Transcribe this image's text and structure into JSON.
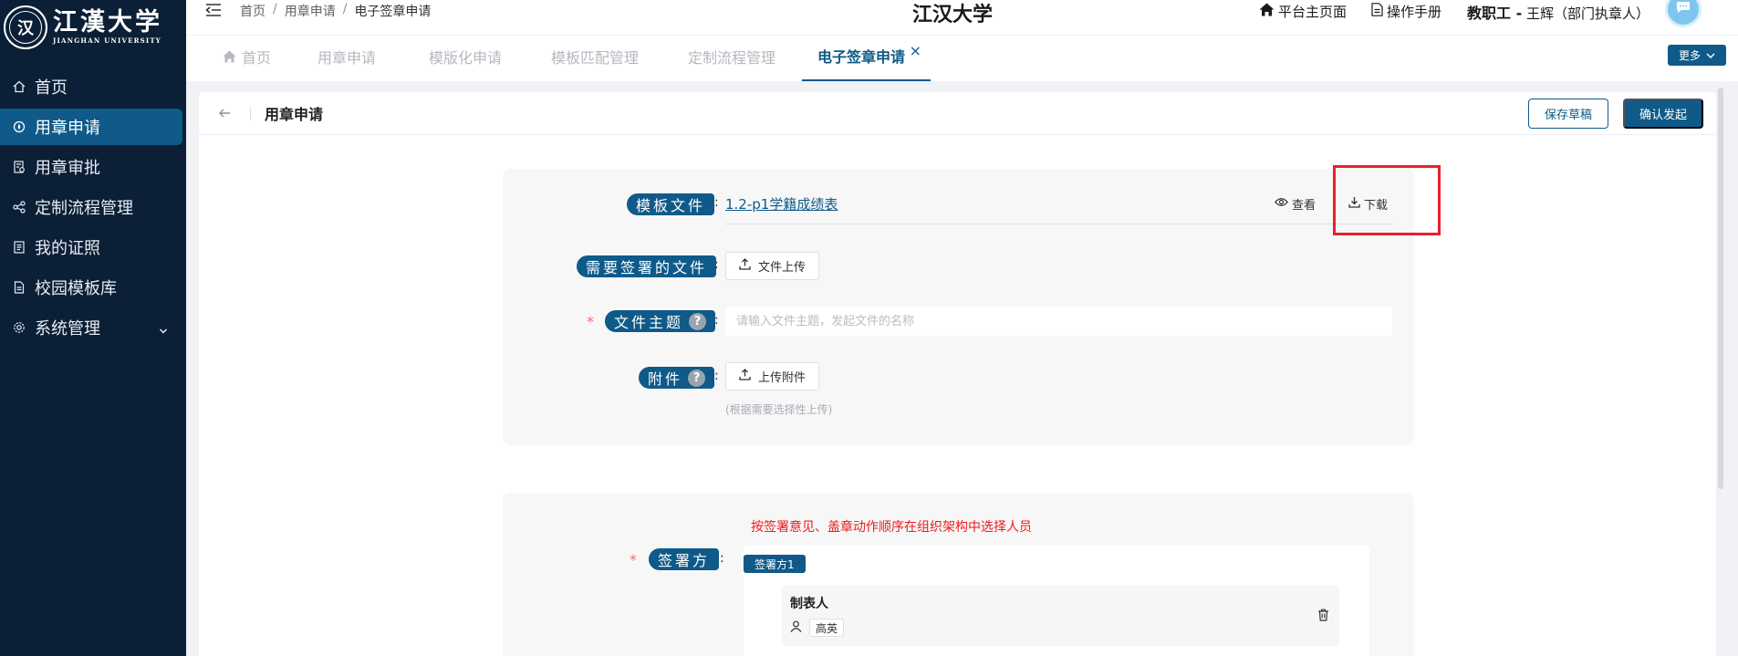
{
  "sidebar": {
    "logo_cn": "江漢大学",
    "logo_en": "JIANGHAN UNIVERSITY",
    "logo_seal": "汉",
    "items": [
      {
        "label": "首页",
        "icon": "home-icon"
      },
      {
        "label": "用章申请",
        "icon": "compass-icon"
      },
      {
        "label": "用章审批",
        "icon": "doc-check-icon"
      },
      {
        "label": "定制流程管理",
        "icon": "share-icon"
      },
      {
        "label": "我的证照",
        "icon": "list-icon"
      },
      {
        "label": "校园模板库",
        "icon": "document-icon"
      },
      {
        "label": "系统管理",
        "icon": "gear-icon"
      }
    ]
  },
  "header": {
    "breadcrumb": [
      "首页",
      "用章申请",
      "电子签章申请"
    ],
    "breadcrumb_sep": "/",
    "title": "江汉大学",
    "home_link": "平台主页面",
    "manual_link": "操作手册",
    "user_role": "教职工 -",
    "user_name": "王辉（部门执章人）"
  },
  "tabs": {
    "items": [
      "首页",
      "用章申请",
      "模版化申请",
      "模板匹配管理",
      "定制流程管理",
      "电子签章申请"
    ],
    "close": "×",
    "more": "更多"
  },
  "page": {
    "title": "用章申请",
    "save_draft": "保存草稿",
    "confirm": "确认发起"
  },
  "form": {
    "colon": ":",
    "required_mark": "*",
    "template_label": "模板文件",
    "template_file": "1.2-p1学籍成绩表",
    "view": "查看",
    "download": "下载",
    "sign_file_label": "需要签署的文件",
    "file_upload": "文件上传",
    "subject_label": "文件主题",
    "subject_placeholder": "请输入文件主题，发起文件的名称",
    "attachment_label": "附件",
    "attachment_upload": "上传附件",
    "attachment_hint": "(根据需要选择性上传)",
    "help": "?"
  },
  "signers": {
    "note": "按签署意见、盖章动作顺序在组织架构中选择人员",
    "label": "签署方",
    "tag": "签署方1",
    "maker_title": "制表人",
    "maker_name": "高英"
  },
  "colors": {
    "primary": "#0f5a88",
    "sidebar_bg": "#0b1f36",
    "danger": "#ea1c1c"
  }
}
